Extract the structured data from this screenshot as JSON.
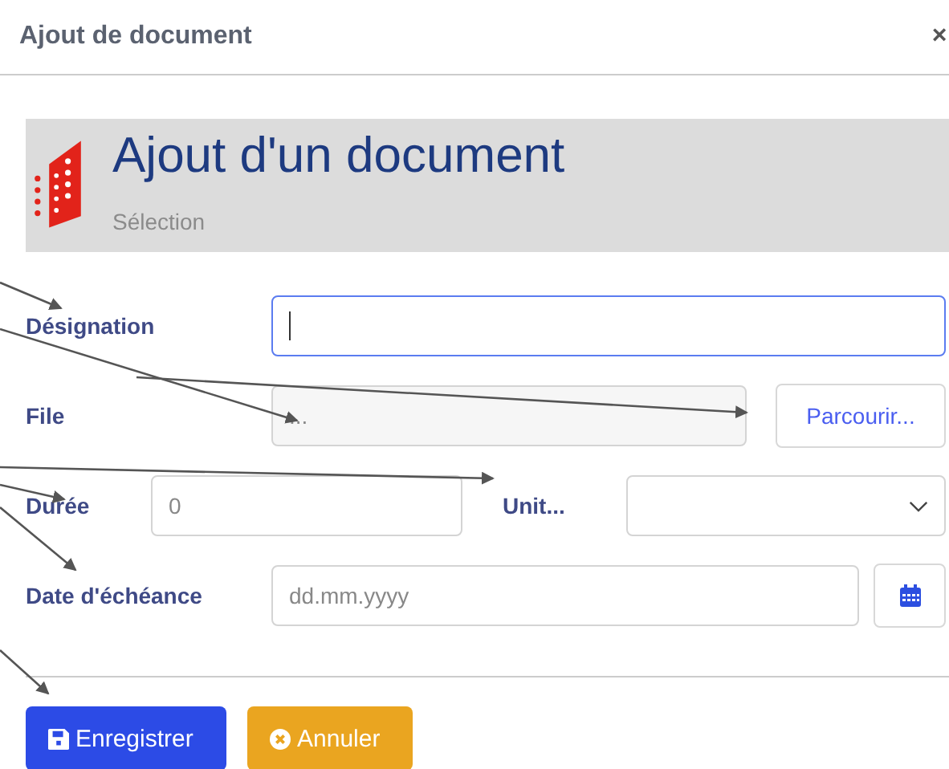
{
  "dialog": {
    "title": "Ajout de document",
    "close": "×"
  },
  "header": {
    "title": "Ajout d'un document",
    "subtitle": "Sélection"
  },
  "fields": [
    {
      "kind": "text",
      "label": "Désignation",
      "focused": true
    },
    {
      "kind": "file",
      "label": "File",
      "value": "...",
      "button": "Parcourir..."
    },
    {
      "kind": "duration",
      "label": "Durée",
      "placeholder": "0",
      "unit_label": "Unit..."
    },
    {
      "kind": "date",
      "label": "Date d'échéance",
      "placeholder": "dd.mm.yyyy"
    }
  ],
  "buttons": [
    {
      "kind": "save",
      "label": "Enregistrer"
    },
    {
      "kind": "cancel",
      "label": "Annuler"
    }
  ]
}
